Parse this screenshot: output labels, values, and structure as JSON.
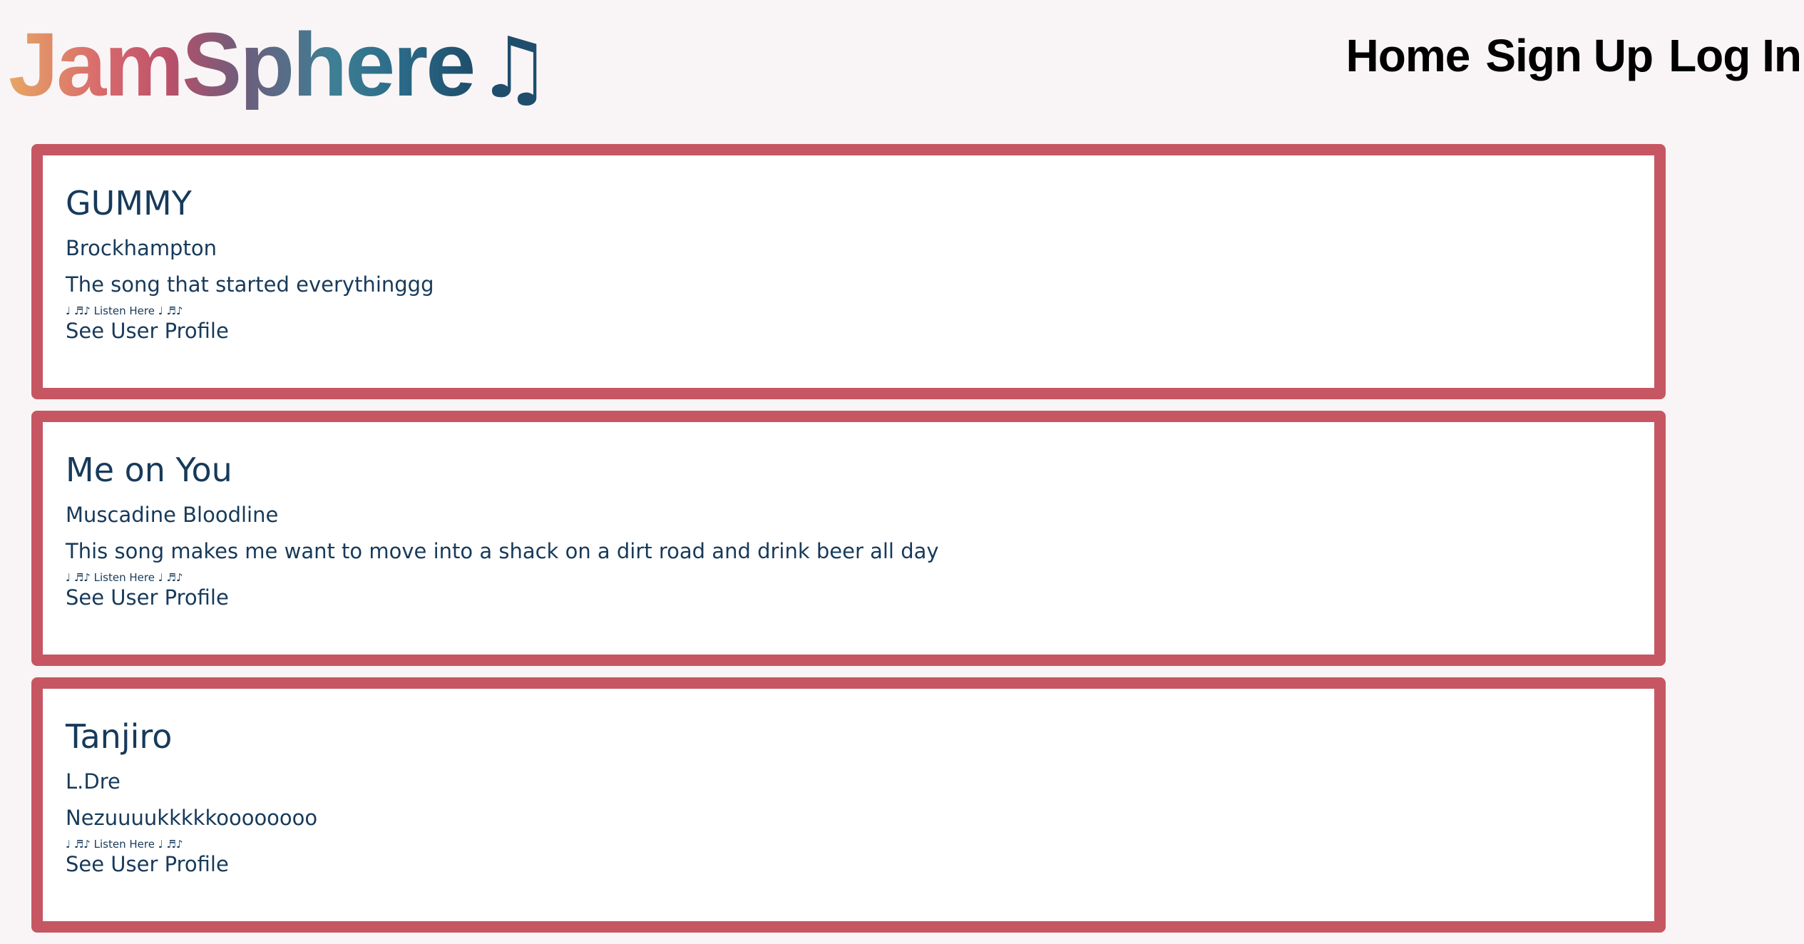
{
  "logo": {
    "text": "JamSphere",
    "note": "♫"
  },
  "nav": {
    "home": "Home",
    "signup": "Sign Up",
    "login": "Log In"
  },
  "posts": [
    {
      "title": "GUMMY",
      "artist": "Brockhampton",
      "description": "The song that started everythinggg",
      "listen": "♩ ♬♪ Listen Here ♩ ♬♪",
      "profile": "See User Profile"
    },
    {
      "title": "Me on You",
      "artist": "Muscadine Bloodline",
      "description": "This song makes me want to move into a shack on a dirt road and drink beer all day",
      "listen": "♩ ♬♪ Listen Here ♩ ♬♪",
      "profile": "See User Profile"
    },
    {
      "title": "Tanjiro",
      "artist": "L.Dre",
      "description": "Nezuuuukkkkkoooooooo",
      "listen": "♩ ♬♪ Listen Here ♩ ♬♪",
      "profile": "See User Profile"
    }
  ],
  "colors": {
    "background": "#f9f5f6",
    "card_border": "#c65762",
    "card_text": "#173a5a",
    "nav_text": "#000000"
  }
}
